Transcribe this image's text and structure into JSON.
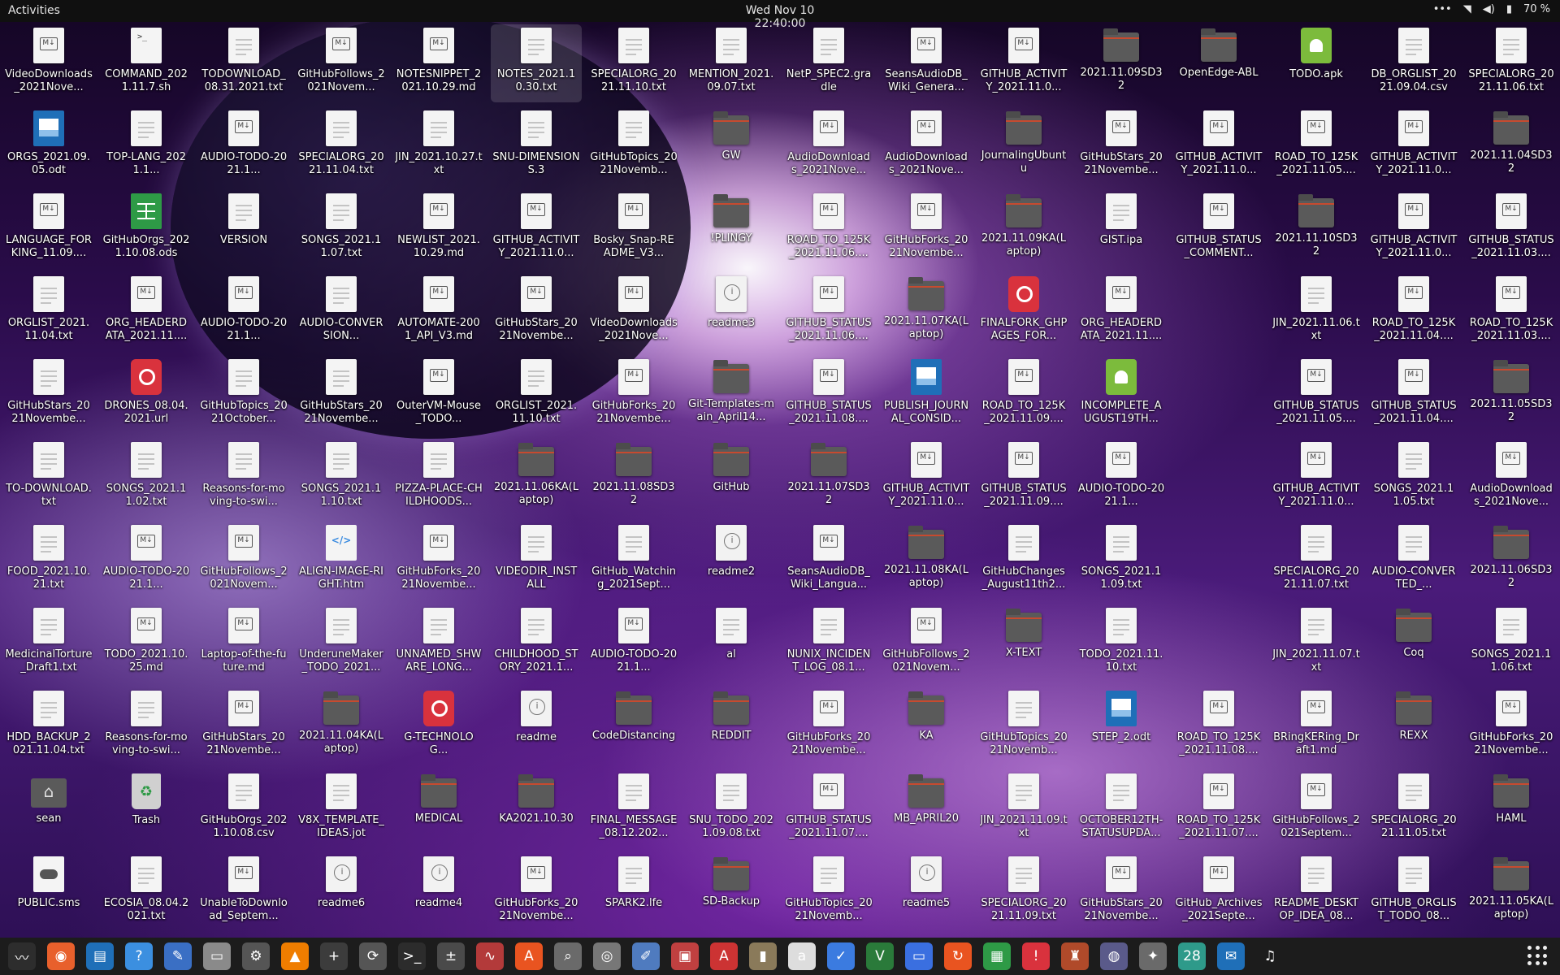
{
  "topbar": {
    "activities": "Activities",
    "clock": "Wed Nov 10  22:40:00",
    "battery": "70 %"
  },
  "desktop": {
    "columns": [
      [
        {
          "label": "VideoDownloads_2021Nove...",
          "icon": "md"
        },
        {
          "label": "ORGS_2021.09.05.odt",
          "icon": "odt"
        },
        {
          "label": "LANGUAGE_FORKING_11.09....",
          "icon": "md"
        },
        {
          "label": "ORGLIST_2021.11.04.txt",
          "icon": "file"
        },
        {
          "label": "GitHubStars_2021Novembe...",
          "icon": "file"
        },
        {
          "label": "TO-DOWNLOAD.txt",
          "icon": "file"
        },
        {
          "label": "FOOD_2021.10.21.txt",
          "icon": "file"
        },
        {
          "label": "MedicinalTorture_Draft1.txt",
          "icon": "file"
        },
        {
          "label": "HDD_BACKUP_2021.11.04.txt",
          "icon": "file"
        },
        {
          "label": "sean",
          "icon": "home"
        },
        {
          "label": "PUBLIC.sms",
          "icon": "game"
        }
      ],
      [
        {
          "label": "COMMAND_2021.11.7.sh",
          "icon": "sh"
        },
        {
          "label": "TOP-LANG_2021.1...",
          "icon": "file"
        },
        {
          "label": "GitHubOrgs_2021.10.08.ods",
          "icon": "ods"
        },
        {
          "label": "ORG_HEADERDATA_2021.11....",
          "icon": "md"
        },
        {
          "label": "DRONES_08.04.2021.url",
          "icon": "url"
        },
        {
          "label": "SONGS_2021.11.02.txt",
          "icon": "file"
        },
        {
          "label": "AUDIO-TODO-2021.1...",
          "icon": "md"
        },
        {
          "label": "TODO_2021.10.25.md",
          "icon": "md"
        },
        {
          "label": "Reasons-for-moving-to-swi...",
          "icon": "file"
        },
        {
          "label": "Trash",
          "icon": "trash"
        },
        {
          "label": "ECOSIA_08.04.2021.txt",
          "icon": "file"
        }
      ],
      [
        {
          "label": "TODOWNLOAD_08.31.2021.txt",
          "icon": "file"
        },
        {
          "label": "AUDIO-TODO-2021.1...",
          "icon": "md"
        },
        {
          "label": "VERSION",
          "icon": "file"
        },
        {
          "label": "AUDIO-TODO-2021.1...",
          "icon": "md"
        },
        {
          "label": "GitHubTopics_2021October...",
          "icon": "file"
        },
        {
          "label": "Reasons-for-moving-to-swi...",
          "icon": "file"
        },
        {
          "label": "GitHubFollows_2021Novem...",
          "icon": "md"
        },
        {
          "label": "Laptop-of-the-future.md",
          "icon": "md"
        },
        {
          "label": "GitHubStars_2021Novembe...",
          "icon": "md"
        },
        {
          "label": "GitHubOrgs_2021.10.08.csv",
          "icon": "file"
        },
        {
          "label": "UnableToDownload_Septem...",
          "icon": "md"
        }
      ],
      [
        {
          "label": "GitHubFollows_2021Novem...",
          "icon": "md"
        },
        {
          "label": "SPECIALORG_2021.11.04.txt",
          "icon": "file"
        },
        {
          "label": "SONGS_2021.11.07.txt",
          "icon": "file"
        },
        {
          "label": "AUDIO-CONVERSION...",
          "icon": "file"
        },
        {
          "label": "GitHubStars_2021Novembe...",
          "icon": "file"
        },
        {
          "label": "SONGS_2021.11.10.txt",
          "icon": "file"
        },
        {
          "label": "ALIGN-IMAGE-RIGHT.htm",
          "icon": "html"
        },
        {
          "label": "UnderuneMaker_TODO_2021...",
          "icon": "file"
        },
        {
          "label": "2021.11.04KA(Laptop)",
          "icon": "folder"
        },
        {
          "label": "V8X_TEMPLATE_IDEAS.jot",
          "icon": "file"
        },
        {
          "label": "readme6",
          "icon": "info"
        }
      ],
      [
        {
          "label": "NOTESNIPPET_2021.10.29.md",
          "icon": "md"
        },
        {
          "label": "JIN_2021.10.27.txt",
          "icon": "file"
        },
        {
          "label": "NEWLIST_2021.10.29.md",
          "icon": "md"
        },
        {
          "label": "AUTOMATE-2001_API_V3.md",
          "icon": "md"
        },
        {
          "label": "OuterVM-Mouse_TODO...",
          "icon": "md"
        },
        {
          "label": "PIZZA-PLACE-CHILDHOODS...",
          "icon": "file"
        },
        {
          "label": "GitHubForks_2021Novembe...",
          "icon": "md"
        },
        {
          "label": "UNNAMED_SHWARE_LONG...",
          "icon": "file"
        },
        {
          "label": "G-TECHNOLOG...",
          "icon": "url"
        },
        {
          "label": "MEDICAL",
          "icon": "folder"
        },
        {
          "label": "readme4",
          "icon": "info"
        }
      ],
      [
        {
          "label": "NOTES_2021.10.30.txt",
          "icon": "file",
          "selected": true
        },
        {
          "label": "SNU-DIMENSIONS.3",
          "icon": "file"
        },
        {
          "label": "GITHUB_ACTIVITY_2021.11.0...",
          "icon": "md"
        },
        {
          "label": "GitHubStars_2021Novembe...",
          "icon": "md"
        },
        {
          "label": "ORGLIST_2021.11.10.txt",
          "icon": "file"
        },
        {
          "label": "2021.11.06KA(Laptop)",
          "icon": "folder"
        },
        {
          "label": "VIDEODIR_INSTALL",
          "icon": "file"
        },
        {
          "label": "CHILDHOOD_STORY_2021.1...",
          "icon": "file"
        },
        {
          "label": "readme",
          "icon": "info"
        },
        {
          "label": "KA2021.10.30",
          "icon": "folder"
        },
        {
          "label": "GitHubForks_2021Novembe...",
          "icon": "md"
        }
      ],
      [
        {
          "label": "SPECIALORG_2021.11.10.txt",
          "icon": "file"
        },
        {
          "label": "GitHubTopics_2021Novemb...",
          "icon": "file"
        },
        {
          "label": "Bosky_Snap-README_V3...",
          "icon": "md"
        },
        {
          "label": "VideoDownloads_2021Nove...",
          "icon": "md"
        },
        {
          "label": "GitHubForks_2021Novembe...",
          "icon": "md"
        },
        {
          "label": "2021.11.08SD32",
          "icon": "folder"
        },
        {
          "label": "GitHub_Watching_2021Sept...",
          "icon": "file"
        },
        {
          "label": "AUDIO-TODO-2021.1...",
          "icon": "md"
        },
        {
          "label": "CodeDistancing",
          "icon": "folder"
        },
        {
          "label": "FINAL_MESSAGE_08.12.202...",
          "icon": "file"
        },
        {
          "label": "SPARK2.lfe",
          "icon": "file"
        }
      ],
      [
        {
          "label": "MENTION_2021.09.07.txt",
          "icon": "file"
        },
        {
          "label": "GW",
          "icon": "folder"
        },
        {
          "label": "!PLINGY",
          "icon": "folder"
        },
        {
          "label": "readme3",
          "icon": "info"
        },
        {
          "label": "Git-Templates-main_April14...",
          "icon": "folder"
        },
        {
          "label": "GitHub",
          "icon": "folder"
        },
        {
          "label": "readme2",
          "icon": "info"
        },
        {
          "label": "al",
          "icon": "file"
        },
        {
          "label": "REDDIT",
          "icon": "folder"
        },
        {
          "label": "SNU_TODO_2021.09.08.txt",
          "icon": "file"
        },
        {
          "label": "SD-Backup",
          "icon": "folder"
        }
      ],
      [
        {
          "label": "NetP_SPEC2.gradle",
          "icon": "file"
        },
        {
          "label": "AudioDownloads_2021Nove...",
          "icon": "md"
        },
        {
          "label": "ROAD_TO_125K_2021.11.06....",
          "icon": "md"
        },
        {
          "label": "GITHUB_STATUS_2021.11.06....",
          "icon": "md"
        },
        {
          "label": "GITHUB_STATUS_2021.11.08....",
          "icon": "md"
        },
        {
          "label": "2021.11.07SD32",
          "icon": "folder"
        },
        {
          "label": "SeansAudioDB_Wiki_Langua...",
          "icon": "md"
        },
        {
          "label": "NUNIX_INCIDENT_LOG_08.1...",
          "icon": "file"
        },
        {
          "label": "GitHubForks_2021Novembe...",
          "icon": "md"
        },
        {
          "label": "GITHUB_STATUS_2021.11.07....",
          "icon": "md"
        },
        {
          "label": "GitHubTopics_2021Novemb...",
          "icon": "file"
        }
      ],
      [
        {
          "label": "SeansAudioDB_Wiki_Genera...",
          "icon": "md"
        },
        {
          "label": "AudioDownloads_2021Nove...",
          "icon": "md"
        },
        {
          "label": "GitHubForks_2021Novembe...",
          "icon": "md"
        },
        {
          "label": "2021.11.07KA(Laptop)",
          "icon": "folder"
        },
        {
          "label": "PUBLISH_JOURNAL_CONSID...",
          "icon": "odt"
        },
        {
          "label": "GITHUB_ACTIVITY_2021.11.0...",
          "icon": "md"
        },
        {
          "label": "2021.11.08KA(Laptop)",
          "icon": "folder"
        },
        {
          "label": "GitHubFollows_2021Novem...",
          "icon": "md"
        },
        {
          "label": "KA",
          "icon": "folder"
        },
        {
          "label": "MB_APRIL20",
          "icon": "folder"
        },
        {
          "label": "readme5",
          "icon": "info"
        }
      ],
      [
        {
          "label": "GITHUB_ACTIVITY_2021.11.0...",
          "icon": "md"
        },
        {
          "label": "JournalingUbuntu",
          "icon": "folder"
        },
        {
          "label": "2021.11.09KA(Laptop)",
          "icon": "folder"
        },
        {
          "label": "FINALFORK_GHPAGES_FOR...",
          "icon": "url"
        },
        {
          "label": "ROAD_TO_125K_2021.11.09....",
          "icon": "md"
        },
        {
          "label": "GITHUB_STATUS_2021.11.09....",
          "icon": "md"
        },
        {
          "label": "GitHubChanges_August11th2...",
          "icon": "file"
        },
        {
          "label": "X-TEXT",
          "icon": "folder"
        },
        {
          "label": "GitHubTopics_2021Novemb...",
          "icon": "file"
        },
        {
          "label": "JIN_2021.11.09.txt",
          "icon": "file"
        },
        {
          "label": "SPECIALORG_2021.11.09.txt",
          "icon": "file"
        }
      ],
      [
        {
          "label": "2021.11.09SD32",
          "icon": "folder"
        },
        {
          "label": "GitHubStars_2021Novembe...",
          "icon": "md"
        },
        {
          "label": "GIST.ipa",
          "icon": "file"
        },
        {
          "label": "ORG_HEADERDATA_2021.11....",
          "icon": "md"
        },
        {
          "label": "INCOMPLETE_AUGUST19TH...",
          "icon": "apk"
        },
        {
          "label": "AUDIO-TODO-2021.1...",
          "icon": "md"
        },
        {
          "label": "SONGS_2021.11.09.txt",
          "icon": "file"
        },
        {
          "label": "TODO_2021.11.10.txt",
          "icon": "file"
        },
        {
          "label": "STEP_2.odt",
          "icon": "odt"
        },
        {
          "label": "OCTOBER12TH-STATUSUPDA...",
          "icon": "file"
        },
        {
          "label": "GitHubStars_2021Novembe...",
          "icon": "md"
        }
      ],
      [
        {
          "label": "OpenEdge-ABL",
          "icon": "folder"
        },
        {
          "label": "GITHUB_ACTIVITY_2021.11.0...",
          "icon": "md"
        },
        {
          "label": "GITHUB_STATUS_COMMENT...",
          "icon": "md"
        },
        null,
        null,
        null,
        null,
        null,
        {
          "label": "ROAD_TO_125K_2021.11.08....",
          "icon": "md"
        },
        {
          "label": "ROAD_TO_125K_2021.11.07....",
          "icon": "md"
        },
        {
          "label": "GitHub_Archives_2021Septe...",
          "icon": "md"
        }
      ],
      [
        {
          "label": "TODO.apk",
          "icon": "apk"
        },
        {
          "label": "ROAD_TO_125K_2021.11.05....",
          "icon": "md"
        },
        {
          "label": "2021.11.10SD32",
          "icon": "folder"
        },
        {
          "label": "JIN_2021.11.06.txt",
          "icon": "file"
        },
        {
          "label": "GITHUB_STATUS_2021.11.05....",
          "icon": "md"
        },
        {
          "label": "GITHUB_ACTIVITY_2021.11.0...",
          "icon": "md"
        },
        {
          "label": "SPECIALORG_2021.11.07.txt",
          "icon": "file"
        },
        {
          "label": "JIN_2021.11.07.txt",
          "icon": "file"
        },
        {
          "label": "BRingKERing_Draft1.md",
          "icon": "md"
        },
        {
          "label": "GitHubFollows_2021Septem...",
          "icon": "md"
        },
        {
          "label": "README_DESKTOP_IDEA_08...",
          "icon": "file"
        }
      ],
      [
        {
          "label": "DB_ORGLIST_2021.09.04.csv",
          "icon": "file"
        },
        {
          "label": "GITHUB_ACTIVITY_2021.11.0...",
          "icon": "md"
        },
        {
          "label": "GITHUB_ACTIVITY_2021.11.0...",
          "icon": "md"
        },
        {
          "label": "ROAD_TO_125K_2021.11.04....",
          "icon": "md"
        },
        {
          "label": "GITHUB_STATUS_2021.11.04....",
          "icon": "md"
        },
        {
          "label": "SONGS_2021.11.05.txt",
          "icon": "file"
        },
        {
          "label": "AUDIO-CONVERTED_...",
          "icon": "file"
        },
        {
          "label": "Coq",
          "icon": "folder"
        },
        {
          "label": "REXX",
          "icon": "folder"
        },
        {
          "label": "SPECIALORG_2021.11.05.txt",
          "icon": "file"
        },
        {
          "label": "GITHUB_ORGLIST_TODO_08...",
          "icon": "file"
        }
      ],
      [
        {
          "label": "SPECIALORG_2021.11.06.txt",
          "icon": "file"
        },
        {
          "label": "2021.11.04SD32",
          "icon": "folder"
        },
        {
          "label": "GITHUB_STATUS_2021.11.03....",
          "icon": "md"
        },
        {
          "label": "ROAD_TO_125K_2021.11.03....",
          "icon": "md"
        },
        {
          "label": "2021.11.05SD32",
          "icon": "folder"
        },
        {
          "label": "AudioDownloads_2021Nove...",
          "icon": "md"
        },
        {
          "label": "2021.11.06SD32",
          "icon": "folder"
        },
        {
          "label": "SONGS_2021.11.06.txt",
          "icon": "file"
        },
        {
          "label": "GitHubForks_2021Novembe...",
          "icon": "md"
        },
        {
          "label": "HAML",
          "icon": "folder"
        },
        {
          "label": "2021.11.05KA(Laptop)",
          "icon": "folder"
        }
      ]
    ]
  },
  "dock": {
    "apps": [
      {
        "name": "system-monitor-icon",
        "glyph": "〰",
        "color": "#2d2d2d"
      },
      {
        "name": "firefox-icon",
        "glyph": "◉",
        "color": "#e8602c"
      },
      {
        "name": "writer-icon",
        "glyph": "▤",
        "color": "#1f6fb8"
      },
      {
        "name": "help-icon",
        "glyph": "?",
        "color": "#3b8fe0"
      },
      {
        "name": "text-editor-icon",
        "glyph": "✎",
        "color": "#3a6fc4"
      },
      {
        "name": "files-icon",
        "glyph": "▭",
        "color": "#8a8a8a"
      },
      {
        "name": "settings-icon",
        "glyph": "⚙",
        "color": "#555555"
      },
      {
        "name": "vlc-icon",
        "glyph": "▲",
        "color": "#ef7d00"
      },
      {
        "name": "terminal-plus-icon",
        "glyph": "+",
        "color": "#3c3c3c"
      },
      {
        "name": "software-updater-icon",
        "glyph": "⟳",
        "color": "#555555"
      },
      {
        "name": "terminal-icon",
        "glyph": ">_",
        "color": "#2c2c2c"
      },
      {
        "name": "calculator-icon",
        "glyph": "±",
        "color": "#4a4a4a"
      },
      {
        "name": "monitor-graph-icon",
        "glyph": "∿",
        "color": "#b33a3a"
      },
      {
        "name": "app-store-icon",
        "glyph": "A",
        "color": "#e95420"
      },
      {
        "name": "image-viewer-icon",
        "glyph": "⌕",
        "color": "#6a6a6a"
      },
      {
        "name": "disk-utility-icon",
        "glyph": "◎",
        "color": "#777777"
      },
      {
        "name": "draw-icon",
        "glyph": "✐",
        "color": "#4f7bbf"
      },
      {
        "name": "screenshot-icon",
        "glyph": "▣",
        "color": "#c04040"
      },
      {
        "name": "document-viewer-icon",
        "glyph": "A",
        "color": "#cc3333"
      },
      {
        "name": "archive-icon",
        "glyph": "▮",
        "color": "#8a7a5a"
      },
      {
        "name": "font-viewer-icon",
        "glyph": "a",
        "color": "#dddddd"
      },
      {
        "name": "tasks-icon",
        "glyph": "✓",
        "color": "#3b7be0"
      },
      {
        "name": "vim-icon",
        "glyph": "V",
        "color": "#2a7a3a"
      },
      {
        "name": "remote-desktop-icon",
        "glyph": "▭",
        "color": "#3a6fe0"
      },
      {
        "name": "backup-icon",
        "glyph": "↻",
        "color": "#e95420"
      },
      {
        "name": "calc-icon",
        "glyph": "▦",
        "color": "#2e9a46"
      },
      {
        "name": "alert-icon",
        "glyph": "!",
        "color": "#d9323d"
      },
      {
        "name": "game-icon",
        "glyph": "♜",
        "color": "#b04a2a"
      },
      {
        "name": "camera-icon",
        "glyph": "◍",
        "color": "#5a5a8a"
      },
      {
        "name": "gimp-icon",
        "glyph": "✦",
        "color": "#6a6a6a"
      },
      {
        "name": "calendar-icon",
        "glyph": "28",
        "color": "#2e9a8a"
      },
      {
        "name": "thunderbird-icon",
        "glyph": "✉",
        "color": "#1f6fb8"
      },
      {
        "name": "music-icon",
        "glyph": "♫",
        "color": "#1c1c1c"
      }
    ]
  }
}
